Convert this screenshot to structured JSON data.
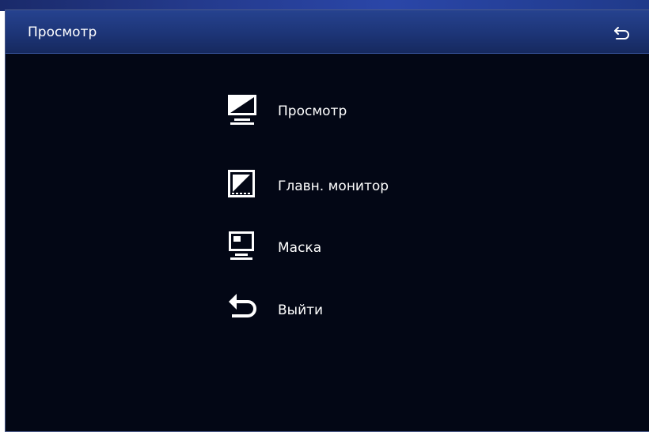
{
  "window": {
    "title": "Просмотр"
  },
  "header": {
    "back_icon": "return-arrow-icon"
  },
  "menu": {
    "items": [
      {
        "label": "Просмотр",
        "icon": "monitor-icon"
      },
      {
        "label": "Главн. монитор",
        "icon": "main-monitor-icon"
      },
      {
        "label": "Маска",
        "icon": "mask-icon"
      },
      {
        "label": "Выйти",
        "icon": "exit-arrow-icon"
      }
    ]
  },
  "colors": {
    "background": "#030715",
    "titlebar": "#1d3577",
    "text": "#ffffff"
  }
}
